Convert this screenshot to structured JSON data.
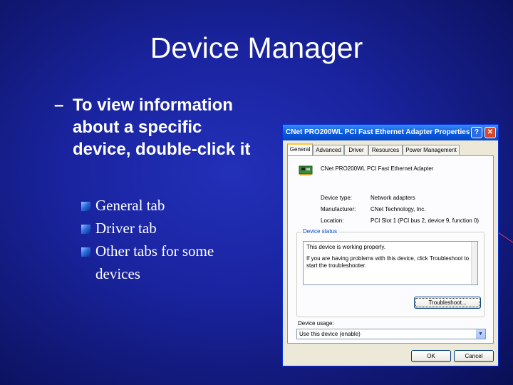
{
  "slide": {
    "title": "Device Manager",
    "bullet_dash": "–",
    "bullet_text": "To view information about a specific device, double-click it",
    "sub_items": [
      "General tab",
      "Driver tab",
      "Other tabs for some devices"
    ]
  },
  "dialog": {
    "title": "CNet PRO200WL PCI Fast Ethernet Adapter Properties",
    "help_label": "?",
    "close_label": "✕",
    "tabs": [
      "General",
      "Advanced",
      "Driver",
      "Resources",
      "Power Management"
    ],
    "device_name": "CNet PRO200WL PCI Fast Ethernet Adapter",
    "properties": {
      "type_label": "Device type:",
      "type_value": "Network adapters",
      "manufacturer_label": "Manufacturer:",
      "manufacturer_value": "CNet Technology, Inc.",
      "location_label": "Location:",
      "location_value": "PCI Slot 1 (PCI bus 2, device 9, function 0)"
    },
    "status_group_label": "Device status",
    "status_line1": "This device is working properly.",
    "status_line2": "If you are having problems with this device, click Troubleshoot to start the troubleshooter.",
    "troubleshoot_label": "Troubleshoot...",
    "usage_label": "Device usage:",
    "usage_value": "Use this device (enable)",
    "ok_label": "OK",
    "cancel_label": "Cancel"
  },
  "colors": {
    "background": "#1a24a0",
    "titlebar": "#0a5ae0",
    "accent_tab": "#ffc83c"
  }
}
